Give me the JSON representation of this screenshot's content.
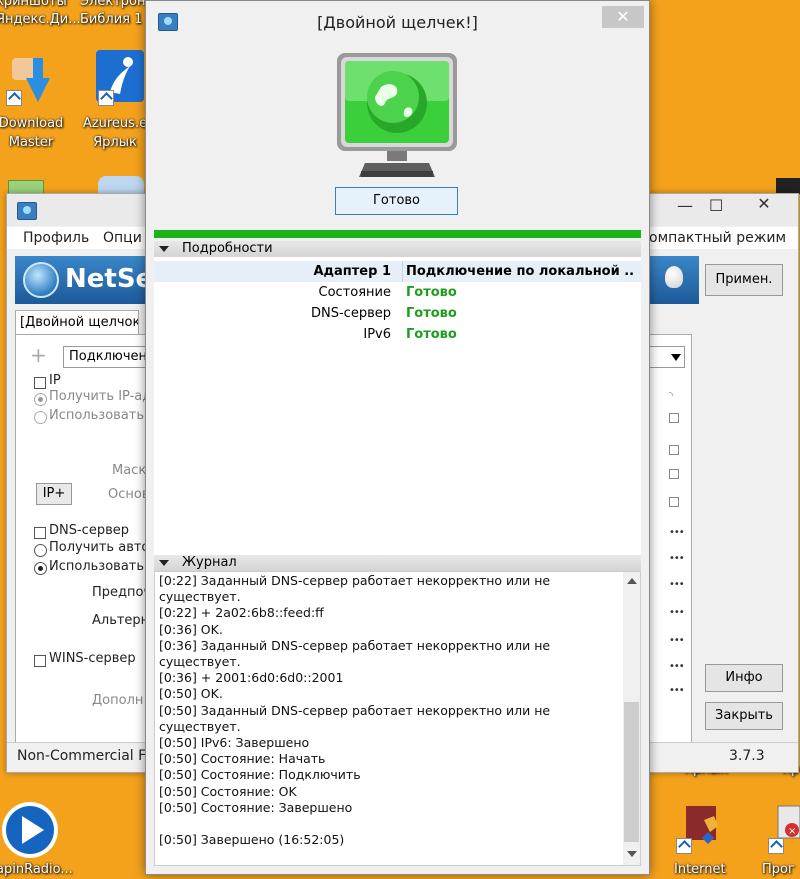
{
  "desktop": {
    "top_labels": [
      "криншоты",
      "Электронная",
      "Яндекс.Ди...",
      "Библия 1"
    ],
    "icon1_label": [
      "Download",
      "Master"
    ],
    "icon2_label": [
      "Azureus.e",
      "Ярлык"
    ],
    "bottom_left_label": "apinRadio...",
    "bottom_right_labels": [
      "Internet",
      "Прог"
    ],
    "right_labels": [
      "Ярлык",
      "Яр"
    ]
  },
  "netsetman": {
    "menu": [
      "Профиль",
      "Опци"
    ],
    "menu_right": "омпактный режим",
    "brand": "NetSe",
    "tab_label": "[Двойной щелчок",
    "profile_dropdown": "Подключени",
    "ip": {
      "checkbox": "IP",
      "auto": "Получить IP-ад",
      "manual": "Использовать",
      "mask": "Маска",
      "gateway": "Основн",
      "ip_plus": "IP+"
    },
    "dns": {
      "checkbox": "DNS-сервер",
      "auto": "Получить авто",
      "manual": "Использовать",
      "preferred": "Предпоч",
      "alternate": "Альтерн"
    },
    "wins": {
      "checkbox": "WINS-сервер",
      "extra": "Дополн"
    },
    "apply_button": "Примен.",
    "info_button": "Инфо",
    "close_button": "Закрыть",
    "status_left": "Non-Commercial F",
    "version": "3.7.3"
  },
  "dialog": {
    "title": "[Двойной щелчек!]",
    "close_glyph": "✕",
    "status_button": "Готово",
    "details_header": "Подробности",
    "details": [
      {
        "key": "Адаптер 1",
        "value": "Подключение по локальной ...",
        "key_bold": true,
        "value_style": "bold"
      },
      {
        "key": "Состояние",
        "value": "Готово",
        "key_bold": false,
        "value_style": "green"
      },
      {
        "key": "DNS-сервер",
        "value": "Готово",
        "key_bold": false,
        "value_style": "green"
      },
      {
        "key": "IPv6",
        "value": "Готово",
        "key_bold": false,
        "value_style": "green"
      }
    ],
    "log_header": "Журнал",
    "log_lines": [
      "[0:22] Заданный DNS-сервер работает некорректно или не",
      "существует.",
      "[0:22] + 2a02:6b8::feed:ff",
      "[0:36] OK.",
      "[0:36] Заданный DNS-сервер работает некорректно или не",
      "существует.",
      "[0:36] + 2001:6d0:6d0::2001",
      "[0:50] OK.",
      "[0:50] Заданный DNS-сервер работает некорректно или не",
      "существует.",
      "[0:50] IPv6: Завершено",
      "[0:50] Состояние: Начать",
      "[0:50] Состояние: Подключить",
      "[0:50] Состояние: OK",
      "[0:50] Состояние: Завершено",
      "",
      "[0:50] Завершено (16:52:05)"
    ]
  },
  "colors": {
    "desktop_bg": "#f4a21c",
    "accent_green": "#1ab31a",
    "status_green": "#1e9e1e"
  }
}
